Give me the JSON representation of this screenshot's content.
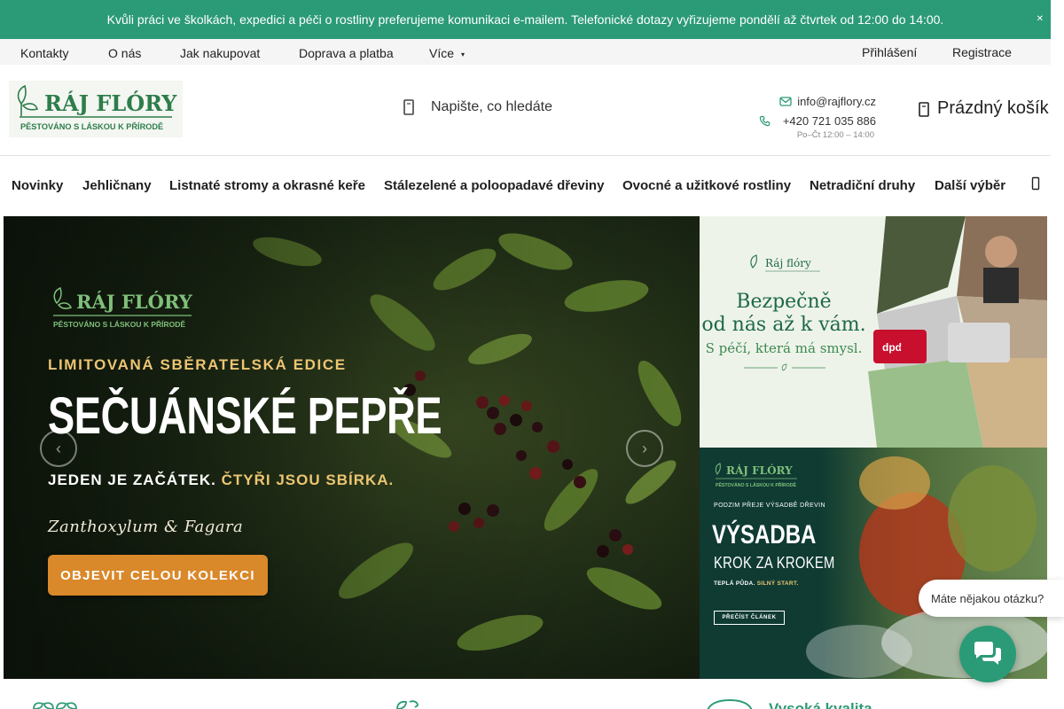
{
  "notice": {
    "text": "Kvůli práci ve školkách, expedici a péči o rostliny preferujeme komunikaci e-mailem. Telefonické dotazy vyřizujeme pondělí až čtvrtek od 12:00 do 14:00."
  },
  "utility_nav": {
    "items": [
      {
        "label": "Kontakty"
      },
      {
        "label": "O nás"
      },
      {
        "label": "Jak nakupovat"
      },
      {
        "label": "Doprava a platba"
      },
      {
        "label": "Více"
      }
    ],
    "login": "Přihlášení",
    "register": "Registrace"
  },
  "header": {
    "logo": {
      "name": "RÁJ FLÓRY",
      "tagline": "PĚSTOVÁNO S LÁSKOU K PŘÍRODĚ"
    },
    "search_placeholder": "Napište, co hledáte",
    "contact": {
      "email": "info@rajflory.cz",
      "phone": "+420 721 035 886",
      "hours": "Po–Čt 12:00 – 14:00"
    },
    "cart_label": "Prázdný košík"
  },
  "main_nav": {
    "items": [
      {
        "label": "Novinky"
      },
      {
        "label": "Jehličnany"
      },
      {
        "label": "Listnaté stromy a okrasné keře"
      },
      {
        "label": "Stálezelené a poloopadavé dřeviny"
      },
      {
        "label": "Ovocné a užitkové rostliny"
      },
      {
        "label": "Netradiční druhy"
      },
      {
        "label": "Další výběr"
      }
    ]
  },
  "hero": {
    "logo_name": "RÁJ FLÓRY",
    "logo_tagline": "PĚSTOVÁNO S LÁSKOU K PŘÍRODĚ",
    "kicker": "LIMITOVANÁ SBĚRATELSKÁ EDICE",
    "title": "SEČUÁNSKÉ PEPŘE",
    "subtitle_a": "JEDEN JE ZAČÁTEK.",
    "subtitle_b": "ČTYŘI JSOU SBÍRKA.",
    "latin": "Zanthoxylum & Fagara",
    "cta": "OBJEVIT CELOU KOLEKCI"
  },
  "banner_shipping": {
    "logo_name": "Ráj flóry",
    "line1": "Bezpečně",
    "line2": "od nás až k vám.",
    "line3": "S péčí, která má smysl.",
    "van_brand_1": "dpd",
    "van_brand_2": "dp"
  },
  "banner_planting": {
    "logo_name": "RÁJ FLÓRY",
    "logo_tagline": "PĚSTOVÁNO S LÁSKOU K PŘÍRODĚ",
    "small": "PODZIM PŘEJE VÝSADBĚ DŘEVIN",
    "title": "VÝSADBA",
    "subtitle": "KROK ZA KROKEM",
    "tag_a": "TEPLÁ PŮDA.",
    "tag_b": "SILNÝ START.",
    "button": "PŘEČÍST ČLÁNEK"
  },
  "chat": {
    "prompt": "Máte nějakou otázku?"
  },
  "features": {
    "third_title": "Vysoká kvalita"
  },
  "colors": {
    "brand_green": "#2b9a77",
    "cta_orange": "#d9882a",
    "accent_gold": "#ecc572"
  }
}
